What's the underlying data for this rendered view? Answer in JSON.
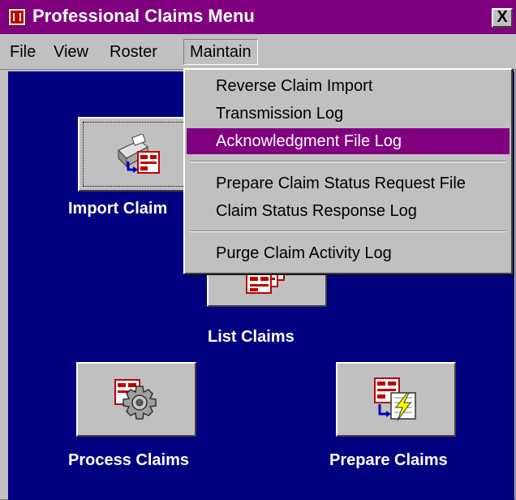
{
  "window": {
    "title": "Professional Claims Menu",
    "close_label": "X"
  },
  "menubar": {
    "items": [
      {
        "label": "File"
      },
      {
        "label": "View"
      },
      {
        "label": "Roster"
      },
      {
        "label": "Maintain",
        "active": true
      }
    ]
  },
  "dropdown": {
    "items": [
      {
        "label": "Reverse Claim Import"
      },
      {
        "label": "Transmission Log"
      },
      {
        "label": "Acknowledgment File Log",
        "highlighted": true
      },
      {
        "label": "Prepare Claim Status Request File"
      },
      {
        "label": "Claim Status Response Log"
      },
      {
        "label": "Purge Claim Activity Log"
      }
    ]
  },
  "buttons": {
    "import": {
      "label": "Import Claim",
      "icon": "import-claims-icon"
    },
    "list": {
      "label": "List Claims",
      "icon": "list-claims-icon"
    },
    "process": {
      "label": "Process Claims",
      "icon": "process-claims-gear-icon"
    },
    "prepare": {
      "label": "Prepare Claims",
      "icon": "prepare-claims-icon"
    }
  },
  "colors": {
    "titlebar": "#800080",
    "client_background": "#000080",
    "highlight": "#800080",
    "chrome": "#c0c0c0"
  }
}
